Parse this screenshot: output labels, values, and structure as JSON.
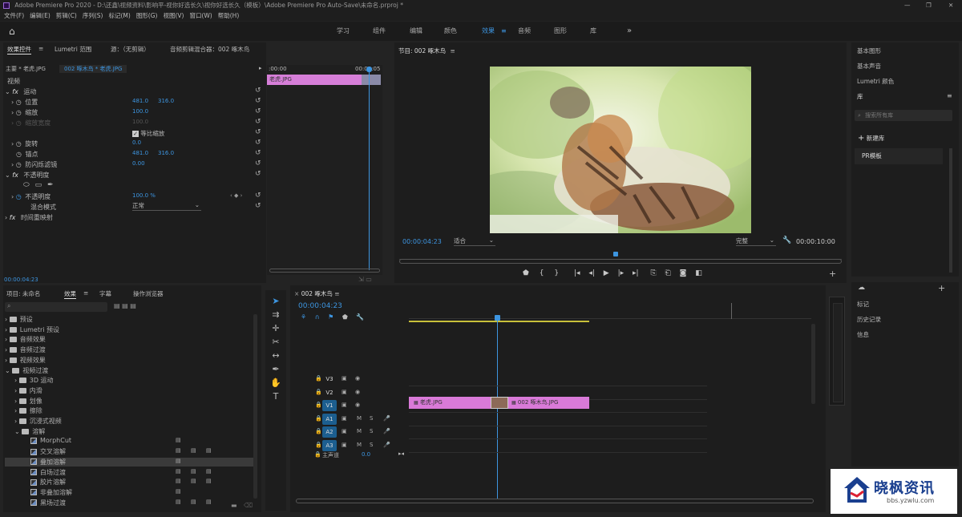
{
  "window": {
    "title": "Adobe Premiere Pro 2020 - D:\\还鑫\\视频资料\\影响平-视你好选长久\\视你好选长久（模板）\\Adobe Premiere Pro Auto-Save\\未命名.prproj *"
  },
  "menu": [
    "文件(F)",
    "编辑(E)",
    "剪辑(C)",
    "序列(S)",
    "标记(M)",
    "图形(G)",
    "视图(V)",
    "窗口(W)",
    "帮助(H)"
  ],
  "workspaces": [
    "学习",
    "组件",
    "编辑",
    "颜色",
    "效果",
    "音频",
    "图形",
    "库"
  ],
  "workspace_active": "效果",
  "effect_controls": {
    "tabs": [
      "效果控件",
      "Lumetri 范围",
      "源：（无剪辑）",
      "音频剪辑混合器：002 啄木鸟"
    ],
    "source": "主要 * 老虎.JPG",
    "sequence": "002 啄木鸟 * 老虎.JPG",
    "ruler_start": ":00:00",
    "ruler_end": "00:00:05",
    "clip": "老虎.JPG",
    "section_video": "视频",
    "motion": "运动",
    "position_label": "位置",
    "position_x": "481.0",
    "position_y": "316.0",
    "scale_label": "缩放",
    "scale": "100.0",
    "scale_width_label": "缩放宽度",
    "scale_width": "100.0",
    "uniform_scale": "等比缩放",
    "rotation_label": "旋转",
    "rotation": "0.0",
    "anchor_label": "锚点",
    "anchor_x": "481.0",
    "anchor_y": "316.0",
    "flicker_label": "防闪烁滤镜",
    "flicker": "0.00",
    "opacity_section": "不透明度",
    "opacity_label": "不透明度",
    "opacity": "100.0 %",
    "blend_label": "混合模式",
    "blend": "正常",
    "remap": "时间重映射",
    "timecode": "00:00:04:23"
  },
  "program": {
    "title": "节目: 002 啄木鸟",
    "timecode": "00:00:04:23",
    "fit": "适合",
    "quality": "完整",
    "duration": "00:00:10:00"
  },
  "right_panel": {
    "items": [
      "基本图形",
      "基本声音",
      "Lumetri 颜色"
    ],
    "lib_title": "库",
    "search_placeholder": "搜索所有库",
    "new_lib": "新建库",
    "lib_item": "PR模板",
    "lower": [
      "标记",
      "历史记录",
      "信息"
    ]
  },
  "project": {
    "tabs": [
      "项目: 未命名",
      "效果",
      "字幕",
      "操作浏览器"
    ],
    "active": "效果"
  },
  "effects_tree": [
    {
      "label": "预设",
      "type": "folder",
      "depth": 0,
      "open": false
    },
    {
      "label": "Lumetri 预设",
      "type": "folder",
      "depth": 0,
      "open": false
    },
    {
      "label": "音频效果",
      "type": "folder",
      "depth": 0,
      "open": false
    },
    {
      "label": "音频过渡",
      "type": "folder",
      "depth": 0,
      "open": false
    },
    {
      "label": "视频效果",
      "type": "folder",
      "depth": 0,
      "open": false
    },
    {
      "label": "视频过渡",
      "type": "folder",
      "depth": 0,
      "open": true
    },
    {
      "label": "3D 运动",
      "type": "folder",
      "depth": 1,
      "open": false
    },
    {
      "label": "内滑",
      "type": "folder",
      "depth": 1,
      "open": false
    },
    {
      "label": "划像",
      "type": "folder",
      "depth": 1,
      "open": false
    },
    {
      "label": "擦除",
      "type": "folder",
      "depth": 1,
      "open": false
    },
    {
      "label": "沉浸式视频",
      "type": "folder",
      "depth": 1,
      "open": false
    },
    {
      "label": "溶解",
      "type": "folder",
      "depth": 1,
      "open": true
    },
    {
      "label": "MorphCut",
      "type": "fx",
      "depth": 2,
      "badges": 1
    },
    {
      "label": "交叉溶解",
      "type": "fx",
      "depth": 2,
      "badges": 3
    },
    {
      "label": "叠加溶解",
      "type": "fx",
      "depth": 2,
      "badges": 1,
      "selected": true
    },
    {
      "label": "白场过渡",
      "type": "fx",
      "depth": 2,
      "badges": 3
    },
    {
      "label": "胶片溶解",
      "type": "fx",
      "depth": 2,
      "badges": 3
    },
    {
      "label": "非叠加溶解",
      "type": "fx",
      "depth": 2,
      "badges": 1
    },
    {
      "label": "黑场过渡",
      "type": "fx",
      "depth": 2,
      "badges": 3
    }
  ],
  "timeline": {
    "title": "002 啄木鸟",
    "timecode": "00:00:04:23",
    "tracks": [
      {
        "name": "V3",
        "type": "video"
      },
      {
        "name": "V2",
        "type": "video"
      },
      {
        "name": "V1",
        "type": "video",
        "target": true
      },
      {
        "name": "A1",
        "type": "audio"
      },
      {
        "name": "A2",
        "type": "audio"
      },
      {
        "name": "A3",
        "type": "audio"
      }
    ],
    "master_label": "主声道",
    "master_value": "0.0",
    "clip_a": "老虎.JPG",
    "clip_b": "002 啄木鸟.JPG"
  },
  "watermark": {
    "brand": "晓枫资讯",
    "url": "bbs.yzwlu.com"
  }
}
